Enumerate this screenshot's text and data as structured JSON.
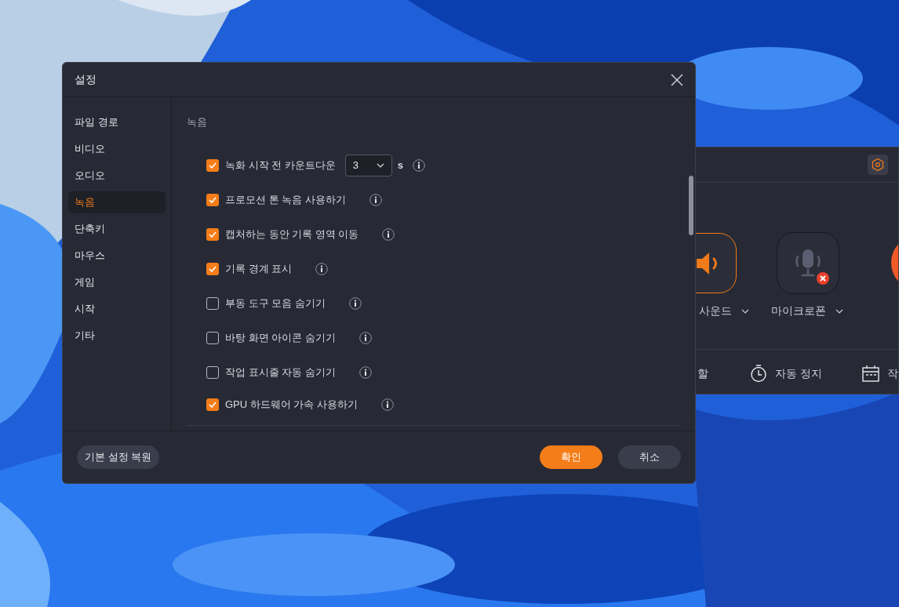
{
  "dialog": {
    "title": "설정",
    "sidebar": {
      "items": [
        {
          "label": "파일 경로",
          "selected": false
        },
        {
          "label": "비디오",
          "selected": false
        },
        {
          "label": "오디오",
          "selected": false
        },
        {
          "label": "녹음",
          "selected": true
        },
        {
          "label": "단축키",
          "selected": false
        },
        {
          "label": "마우스",
          "selected": false
        },
        {
          "label": "게임",
          "selected": false
        },
        {
          "label": "시작",
          "selected": false
        },
        {
          "label": "기타",
          "selected": false
        }
      ]
    },
    "section_title": "녹음",
    "options": [
      {
        "label": "녹화 시작 전 카운트다운",
        "checked": true,
        "select_value": "3",
        "unit": "s"
      },
      {
        "label": "프로모션 톤 녹음 사용하기",
        "checked": true
      },
      {
        "label": "캡처하는 동안 기록 영역 이동",
        "checked": true
      },
      {
        "label": "기록 경계 표시",
        "checked": true
      },
      {
        "label": "부동 도구 모음 숨기기",
        "checked": false
      },
      {
        "label": "바탕 화면 아이콘 숨기기",
        "checked": false
      },
      {
        "label": "작업 표시줄 자동 숨기기",
        "checked": false
      },
      {
        "label": "GPU 하드웨어 가속 사용하기",
        "checked": true
      }
    ],
    "buttons": {
      "reset": "기본 설정 복원",
      "ok": "확인",
      "cancel": "취소"
    }
  },
  "recorder": {
    "sound_label": "사운드",
    "microphone_label": "마이크로폰",
    "microphone_muted": true,
    "toolbar": [
      "할",
      "자동 정지",
      "작"
    ]
  }
}
